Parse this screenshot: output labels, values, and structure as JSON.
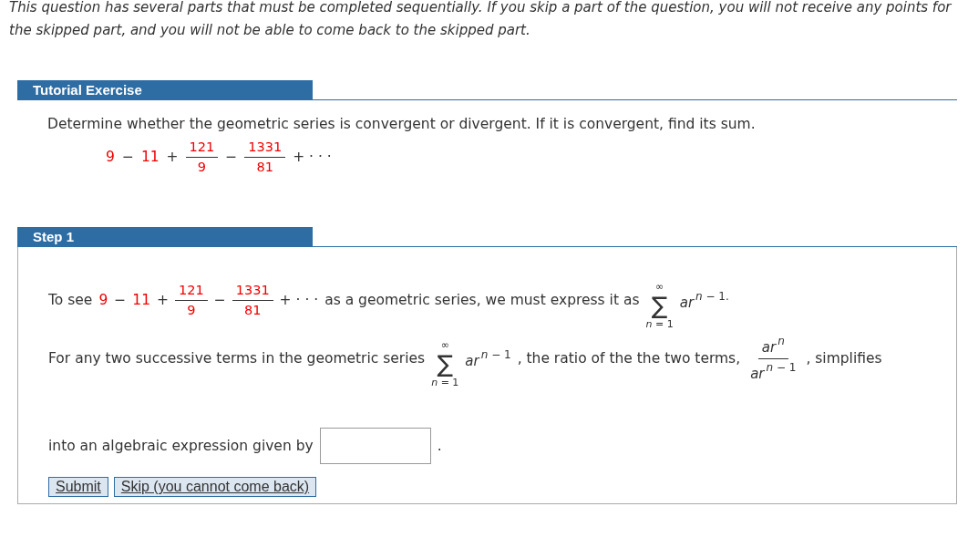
{
  "notice": "This question has several parts that must be completed sequentially. If you skip a part of the question, you will not receive any points for the skipped part, and you will not be able to come back to the skipped part.",
  "tutorial": {
    "header": "Tutorial Exercise",
    "prompt": "Determine whether the geometric series is convergent or divergent. If it is convergent, find its sum.",
    "expression": [
      {
        "kind": "given",
        "text": "9"
      },
      {
        "kind": "op",
        "text": "−"
      },
      {
        "kind": "given",
        "text": "11"
      },
      {
        "kind": "op",
        "text": "+"
      },
      {
        "kind": "frac",
        "num": [
          {
            "kind": "given",
            "text": "121"
          }
        ],
        "den": [
          {
            "kind": "given",
            "text": "9"
          }
        ]
      },
      {
        "kind": "op",
        "text": "−"
      },
      {
        "kind": "frac",
        "num": [
          {
            "kind": "given",
            "text": "1331"
          }
        ],
        "den": [
          {
            "kind": "given",
            "text": "81"
          }
        ]
      },
      {
        "kind": "op",
        "text": "+ · · ·"
      }
    ]
  },
  "step": {
    "header": "Step 1",
    "paragraphs": [
      [
        {
          "kind": "text",
          "text": "To see"
        },
        {
          "kind": "given",
          "text": "9"
        },
        {
          "kind": "op",
          "text": "−"
        },
        {
          "kind": "given",
          "text": "11"
        },
        {
          "kind": "op",
          "text": "+"
        },
        {
          "kind": "frac",
          "num": [
            {
              "kind": "given",
              "text": "121"
            }
          ],
          "den": [
            {
              "kind": "given",
              "text": "9"
            }
          ]
        },
        {
          "kind": "op",
          "text": "−"
        },
        {
          "kind": "frac",
          "num": [
            {
              "kind": "given",
              "text": "1331"
            }
          ],
          "den": [
            {
              "kind": "given",
              "text": "81"
            }
          ]
        },
        {
          "kind": "op",
          "text": "+ · · ·"
        },
        {
          "kind": "text",
          "text": "as a geometric series, we must express it as"
        },
        {
          "kind": "sum",
          "symbol": "∑",
          "upper": "∞",
          "lower": "*n* = 1"
        },
        {
          "kind": "power",
          "base": "*ar*",
          "exp": "*n* − 1."
        }
      ],
      [
        {
          "kind": "text",
          "text": "For any two successive terms in the geometric series"
        },
        {
          "kind": "sum",
          "symbol": "∑",
          "upper": "∞",
          "lower": "*n* = 1"
        },
        {
          "kind": "power",
          "base": "*ar*",
          "exp": "*n* − 1"
        },
        {
          "kind": "text",
          "text": ", the ratio of the the two terms,"
        },
        {
          "kind": "frac",
          "num": [
            {
              "kind": "power",
              "base": "*ar*",
              "exp": "*n*"
            }
          ],
          "den": [
            {
              "kind": "power",
              "base": "*ar*",
              "exp": "*n* − 1"
            }
          ]
        },
        {
          "kind": "text",
          "text": ", simplifies"
        }
      ],
      [
        {
          "kind": "text",
          "text": "into an algebraic expression given by"
        },
        {
          "kind": "field"
        },
        {
          "kind": "text",
          "text": "."
        }
      ]
    ],
    "buttons": [
      "Submit",
      "Skip (you cannot come back)"
    ]
  }
}
